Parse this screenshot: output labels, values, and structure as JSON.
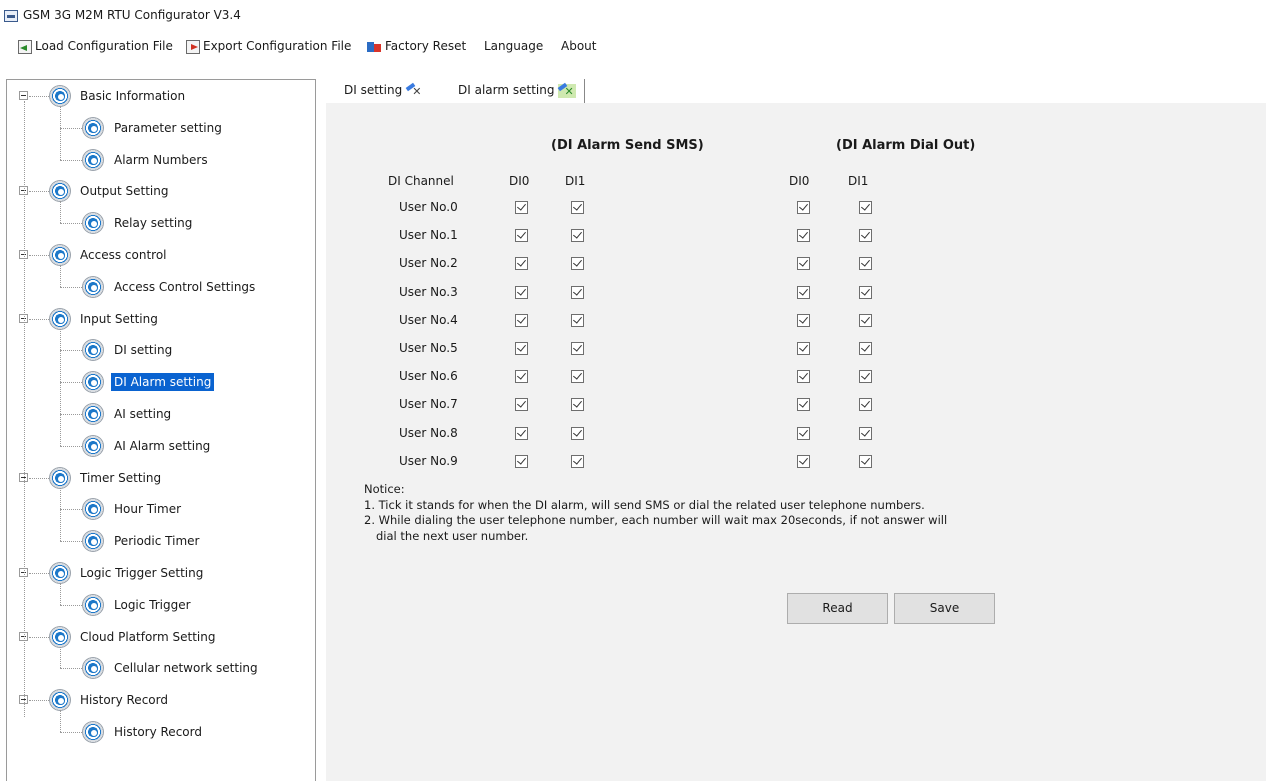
{
  "window": {
    "title": "GSM 3G M2M RTU Configurator V3.4"
  },
  "menu": {
    "load": "Load Configuration File",
    "export": "Export Configuration File",
    "factory_reset": "Factory Reset",
    "language": "Language",
    "about": "About"
  },
  "tree": {
    "groups": [
      {
        "label": "Basic Information",
        "children": [
          "Parameter setting",
          "Alarm Numbers"
        ]
      },
      {
        "label": "Output Setting",
        "children": [
          "Relay setting"
        ]
      },
      {
        "label": "Access control",
        "children": [
          "Access Control Settings"
        ]
      },
      {
        "label": "Input Setting",
        "children": [
          "DI setting",
          "DI Alarm setting",
          "AI setting",
          "AI Alarm setting"
        ]
      },
      {
        "label": "Timer Setting",
        "children": [
          "Hour Timer",
          "Periodic Timer"
        ]
      },
      {
        "label": "Logic Trigger Setting",
        "children": [
          "Logic Trigger"
        ]
      },
      {
        "label": "Cloud Platform Setting",
        "children": [
          "Cellular network setting"
        ]
      },
      {
        "label": "History Record",
        "children": [
          "History Record"
        ]
      }
    ],
    "selected": "DI Alarm setting"
  },
  "tabs": [
    {
      "label": "DI setting",
      "active": false
    },
    {
      "label": "DI alarm setting",
      "active": true
    }
  ],
  "sms_section": {
    "title": "(DI Alarm Send SMS)"
  },
  "dial_section": {
    "title": "(DI Alarm Dial Out)"
  },
  "table": {
    "channel_header": "DI Channel",
    "sms_columns": [
      "DI0",
      "DI1"
    ],
    "dial_columns": [
      "DI0",
      "DI1"
    ],
    "rows": [
      {
        "label": "User No.0",
        "sms": [
          true,
          true
        ],
        "dial": [
          true,
          true
        ]
      },
      {
        "label": "User No.1",
        "sms": [
          true,
          true
        ],
        "dial": [
          true,
          true
        ]
      },
      {
        "label": "User No.2",
        "sms": [
          true,
          true
        ],
        "dial": [
          true,
          true
        ]
      },
      {
        "label": "User No.3",
        "sms": [
          true,
          true
        ],
        "dial": [
          true,
          true
        ]
      },
      {
        "label": "User No.4",
        "sms": [
          true,
          true
        ],
        "dial": [
          true,
          true
        ]
      },
      {
        "label": "User No.5",
        "sms": [
          true,
          true
        ],
        "dial": [
          true,
          true
        ]
      },
      {
        "label": "User No.6",
        "sms": [
          true,
          true
        ],
        "dial": [
          true,
          true
        ]
      },
      {
        "label": "User No.7",
        "sms": [
          true,
          true
        ],
        "dial": [
          true,
          true
        ]
      },
      {
        "label": "User No.8",
        "sms": [
          true,
          true
        ],
        "dial": [
          true,
          true
        ]
      },
      {
        "label": "User No.9",
        "sms": [
          true,
          true
        ],
        "dial": [
          true,
          true
        ]
      }
    ]
  },
  "notice": {
    "title": "Notice:",
    "lines": [
      "1. Tick it stands for when the DI alarm, will send SMS or dial the related user telephone numbers.",
      "2. While dialing the user telephone number, each number will wait max 20seconds, if not answer will",
      "dial the next user number."
    ]
  },
  "buttons": {
    "read": "Read",
    "save": "Save"
  },
  "colors": {
    "selection": "#0a63d0",
    "panel_bg": "#f2f2f2",
    "gear_blue": "#1d78c9"
  }
}
